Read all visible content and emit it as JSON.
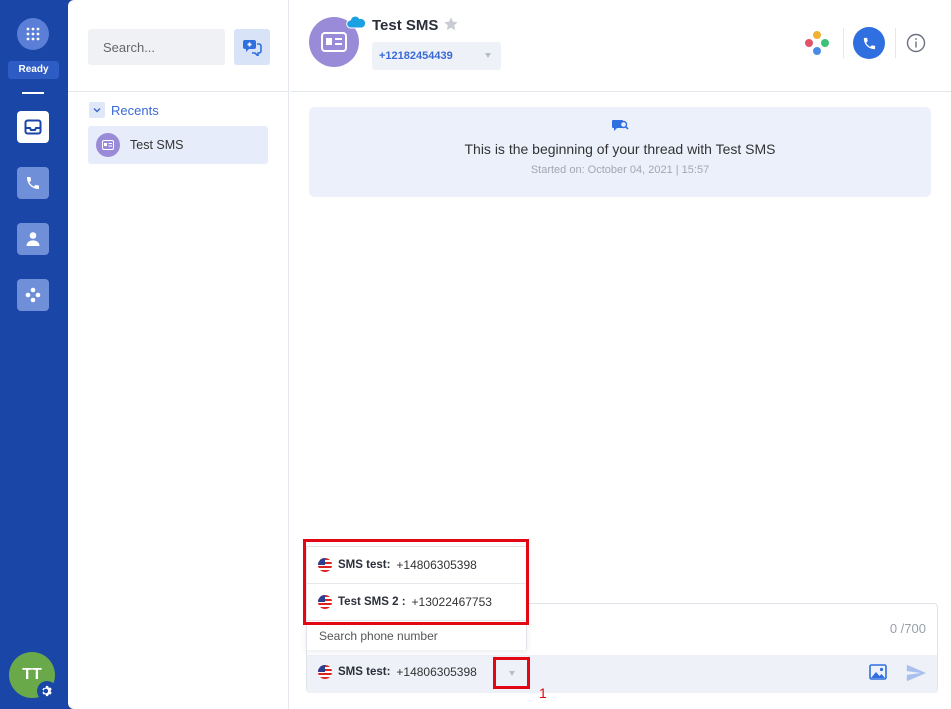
{
  "rail": {
    "status": "Ready",
    "user_initials": "TT"
  },
  "list": {
    "search_placeholder": "Search...",
    "recents_label": "Recents",
    "threads": [
      {
        "name": "Test SMS"
      }
    ]
  },
  "conversation": {
    "contact_name": "Test SMS",
    "contact_number": "+12182454439",
    "thread_start_title": "This is the beginning of your thread with Test SMS",
    "thread_start_subtitle": "Started on: October 04, 2021 | 15:57"
  },
  "composer": {
    "counter": "0 /700",
    "sender_label": "SMS test:",
    "sender_number": "+14806305398"
  },
  "dropdown": {
    "options": [
      {
        "label": "SMS test:",
        "number": "+14806305398"
      },
      {
        "label": "Test SMS 2 :",
        "number": "+13022467753"
      }
    ],
    "search_placeholder": "Search phone number"
  },
  "annotation": {
    "label": "1",
    "color": "#e30613"
  },
  "colors": {
    "brand": "#1a46a8",
    "accent": "#2f6fe0",
    "avatar": "#9a8bd8"
  }
}
